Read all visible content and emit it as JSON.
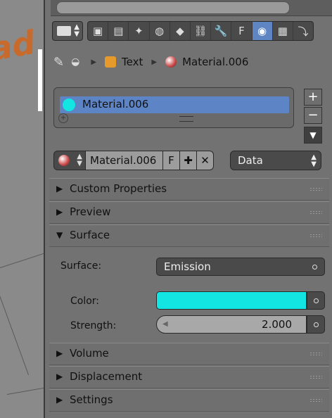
{
  "breadcrumb": {
    "object": "Text",
    "material": "Material.006"
  },
  "material_slots": {
    "items": [
      "Material.006"
    ]
  },
  "datablock": {
    "name": "Material.006",
    "fake_user": "F",
    "link_mode": "Data"
  },
  "sections": {
    "custom_properties": "Custom Properties",
    "preview": "Preview",
    "surface": "Surface",
    "volume": "Volume",
    "displacement": "Displacement",
    "settings": "Settings"
  },
  "surface": {
    "surface_label": "Surface:",
    "surface_value": "Emission",
    "color_label": "Color:",
    "color_value": "#12e5e2",
    "strength_label": "Strength:",
    "strength_value": "2.000"
  },
  "icons": {
    "tabs": [
      "render-icon",
      "render-layers-icon",
      "scene-icon",
      "world-icon",
      "object-icon",
      "constraints-icon",
      "modifiers-icon",
      "data-font-icon",
      "material-icon",
      "texture-icon",
      "physics-icon"
    ],
    "tab_glyphs": [
      "▣",
      "▤",
      "✦",
      "◍",
      "◆",
      "⛓",
      "🔧",
      "F",
      "◉",
      "▦",
      "⤵"
    ]
  },
  "colors": {
    "accent": "#5d84c4",
    "emission": "#12e5e2"
  }
}
